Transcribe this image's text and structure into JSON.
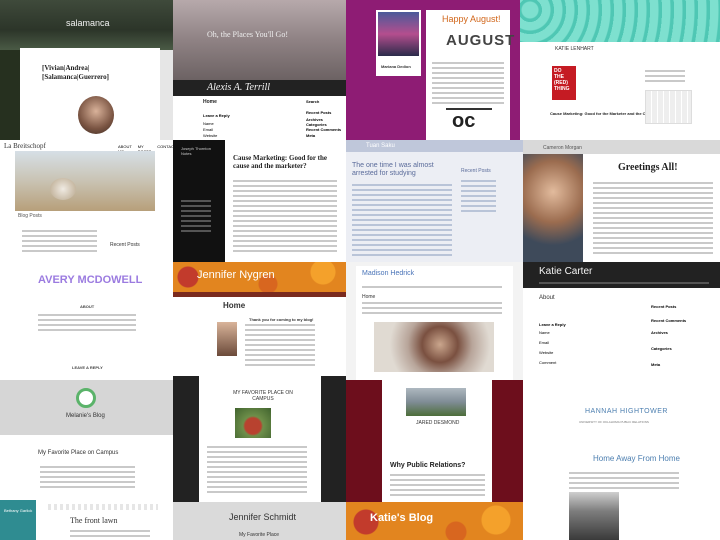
{
  "collage": {
    "tiles": {
      "salamanca": {
        "site_title": "salamanca",
        "heading": "[Vivian|Andrea|[Salamanca|Guerrero]",
        "nav": [
          "Home",
          "About",
          "Contact",
          "Blog"
        ]
      },
      "alexis": {
        "banner": "Oh, the Places You'll Go!",
        "site_title": "Alexis A. Terrill",
        "content_heading": "Home",
        "sidebar_heading": "Search",
        "widgets": [
          "Recent Posts",
          "Archives",
          "Categories",
          "Recent Comments",
          "Meta"
        ],
        "form_labels": [
          "Leave a Reply",
          "Name",
          "Email",
          "Website"
        ]
      },
      "august": {
        "heading": "Happy August!",
        "big_word": "AUGUST",
        "profile_name": "Mariana Dedion"
      },
      "katie_lenhart": {
        "site_title": "KATIE LENHART",
        "book_words": [
          "DO",
          "THE",
          "(RED)",
          "THING"
        ],
        "post_title": "Cause Marketing: Good for the Marketer and the Cause?"
      },
      "breitschopf": {
        "site_title": "La Breitschopf",
        "nav": [
          "ABOUT ME",
          "MY POSTS",
          "CONTACT"
        ],
        "section_heading": "Blog Posts",
        "sidebar_heading": "Recent Posts"
      },
      "joseph": {
        "sidebar_title": "Joseph Thornton Notes",
        "post_title": "Cause Marketing: Good for the cause and the marketer?"
      },
      "ivan": {
        "site_title": "Tuan Saku",
        "post_title": "The one time I was almost arrested for studying",
        "sidebar_heading": "Recent Posts"
      },
      "morgan": {
        "site_title": "Cameron Morgan",
        "heading": "Greetings All!"
      },
      "avery": {
        "site_title": "AVERY MCDOWELL",
        "section": "ABOUT",
        "reply": "LEAVE A REPLY"
      },
      "nygren": {
        "site_title": "Jennifer Nygren",
        "page_title": "Home",
        "intro": "Thank you for coming to my blog!"
      },
      "madison": {
        "site_title": "Madison Hedrick",
        "page_title": "Home"
      },
      "carter": {
        "site_title": "Katie Carter",
        "page_title": "About",
        "widgets": [
          "Recent Posts",
          "Recent Comments",
          "Archives",
          "Categories",
          "Meta"
        ],
        "form_labels": [
          "Leave a Reply",
          "Name",
          "Email",
          "Website",
          "Comment"
        ]
      },
      "melanie": {
        "site_title": "Melanie's Blog",
        "post_title": "My Favorite Place on Campus"
      },
      "campus": {
        "post_title": "MY FAVORITE PLACE ON CAMPUS"
      },
      "jared": {
        "site_title": "JARED DESMOND",
        "post_title": "Why Public Relations?"
      },
      "hightower": {
        "site_title": "HANNAH HIGHTOWER",
        "tagline": "UNIVERSITY OF OKLAHOMA PUBLIC RELATIONS",
        "post_title": "Home Away From Home"
      },
      "frontlawn": {
        "sidebar_title": "Bethany Garlick",
        "post_title": "The front lawn"
      },
      "schmidt": {
        "site_title": "Jennifer Schmidt",
        "post_title": "My Favorite Place"
      },
      "katies_blog": {
        "site_title": "Katie's Blog"
      }
    },
    "colors": {
      "august_purple": "#8e1c74",
      "nygren_orange": "#e2851f",
      "avery_purple": "#9b7be0",
      "teal": "#5ad1c0",
      "jared_maroon": "#6d0e1c"
    }
  }
}
